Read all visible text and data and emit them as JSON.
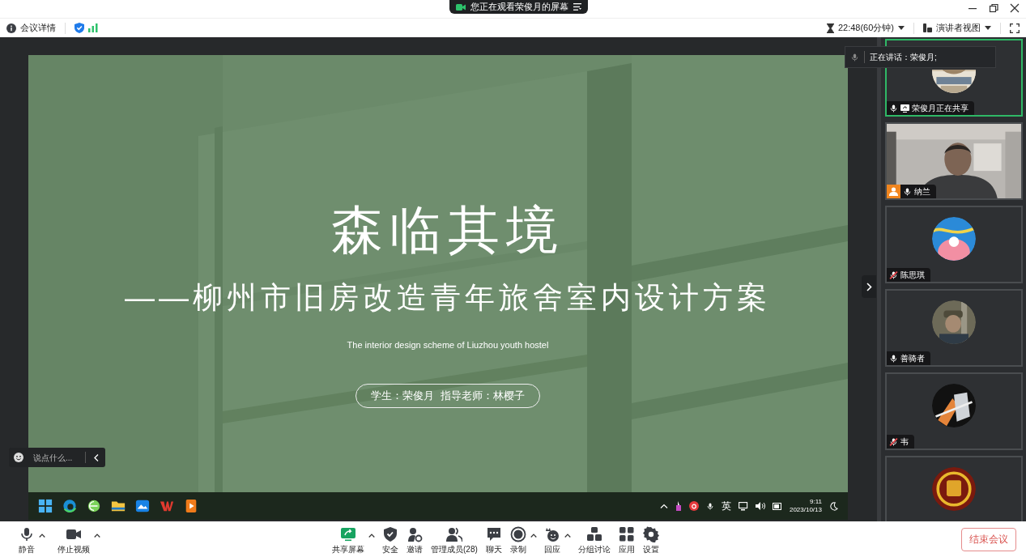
{
  "share_banner": {
    "text": "您正在观看荣俊月的屏幕"
  },
  "info_bar": {
    "details": "会议详情",
    "timer": "22:48(60分钟)",
    "view": "演讲者视图"
  },
  "slide": {
    "title": "森临其境",
    "subtitle": "——柳州市旧房改造青年旅舍室内设计方案",
    "subtitle_en": "The interior design scheme of Liuzhou youth hostel",
    "credits": "学生：荣俊月  指导老师：林樱子"
  },
  "shared_taskbar": {
    "input_method": "英",
    "time": "9:11",
    "date": "2023/10/13"
  },
  "chat_box": {
    "placeholder": "说点什么..."
  },
  "speaking": {
    "text": "正在讲话：荣俊月;"
  },
  "participants": [
    {
      "name": "荣俊月正在共享",
      "kind": "avatar",
      "active": true,
      "muted": false,
      "sharing": true,
      "host": false
    },
    {
      "name": "纳兰",
      "kind": "video",
      "active": false,
      "muted": false,
      "sharing": false,
      "host": true
    },
    {
      "name": "陈思琪",
      "kind": "avatar",
      "active": false,
      "muted": true,
      "sharing": false,
      "host": false
    },
    {
      "name": "善骑者",
      "kind": "avatar",
      "active": false,
      "muted": false,
      "sharing": false,
      "host": false
    },
    {
      "name": "韦",
      "kind": "avatar",
      "active": false,
      "muted": true,
      "sharing": false,
      "host": false
    },
    {
      "kind": "avatar",
      "active": false,
      "muted": false,
      "sharing": false,
      "host": false
    }
  ],
  "toolbar": {
    "left": [
      {
        "label": "静音",
        "menu": true
      },
      {
        "label": "停止视频",
        "menu": true
      }
    ],
    "center": [
      {
        "label": "共享屏幕",
        "menu": true
      },
      {
        "label": "安全",
        "menu": false
      },
      {
        "label": "邀请",
        "menu": false
      },
      {
        "label": "管理成员(28)",
        "menu": false
      },
      {
        "label": "聊天",
        "menu": false
      },
      {
        "label": "录制",
        "menu": true
      },
      {
        "label": "回应",
        "menu": true
      },
      {
        "label": "分组讨论",
        "menu": false
      },
      {
        "label": "应用",
        "menu": false
      },
      {
        "label": "设置",
        "menu": false
      }
    ],
    "end_button": "结束会议"
  }
}
